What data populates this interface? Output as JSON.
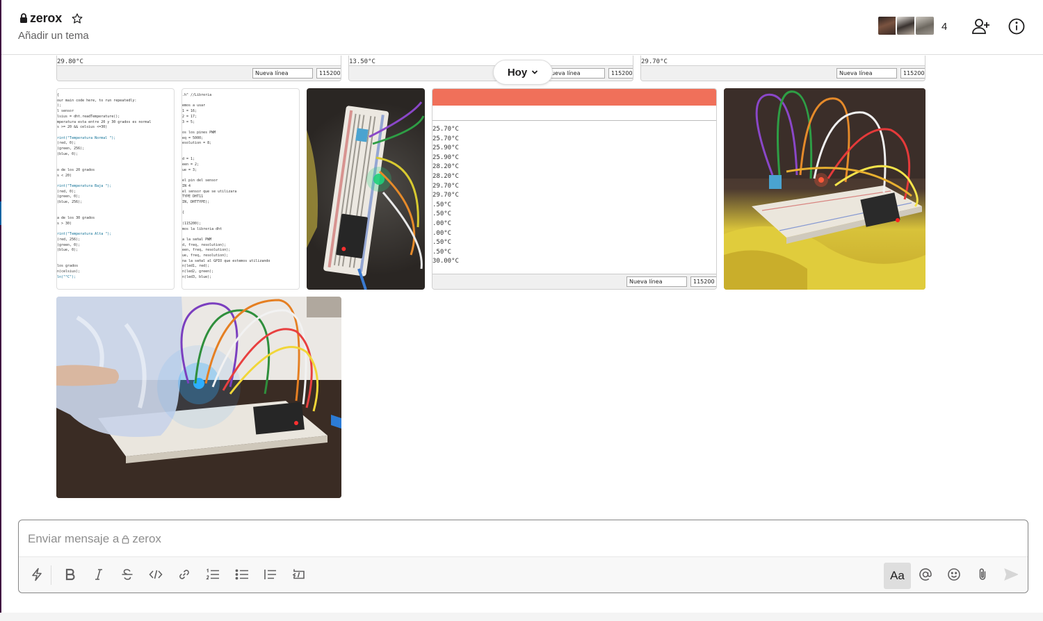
{
  "header": {
    "channel_name": "zerox",
    "topic": "Añadir un tema",
    "member_count": "4"
  },
  "serial_monitors_top": [
    {
      "reading": "29.80°C",
      "line_ending": "Nueva línea",
      "baud": "115200 b"
    },
    {
      "reading": "13.50°C",
      "line_ending": "Nueva línea",
      "baud": "115200 b"
    },
    {
      "reading": "29.70°C",
      "line_ending": "Nueva línea",
      "baud": "115200 b"
    }
  ],
  "date_divider": {
    "label": "Hoy"
  },
  "serial_monitor_big": {
    "readings": [
      "25.70°C",
      "25.70°C",
      "25.90°C",
      "25.90°C",
      "28.20°C",
      "28.20°C",
      "29.70°C",
      "29.70°C",
      ".50°C",
      ".50°C",
      ".00°C",
      ".00°C",
      ".50°C",
      ".50°C",
      "30.00°C"
    ],
    "line_ending": "Nueva línea",
    "baud": "115200 b"
  },
  "code_left": [
    "{",
    "our main code here, to run repeatedly:",
    ");",
    "l sensor",
    "lsius = dht.readTemperature();",
    "mperatura esta entre 20 y 30 grados es normal",
    "s >= 20 && celsius <=30)",
    "",
    "rint(\"Temperatura Normal \");",
    "(red, 0);",
    "(green, 256);",
    "(blue, 0);",
    "",
    "",
    "o de los 20 grados",
    "s < 20)",
    "",
    "rint(\"Temperatura Baja \");",
    "(red, 0);",
    "(green, 0);",
    "(blue, 256);",
    "",
    "",
    "a de los 30 grados",
    "s > 30)",
    "",
    "rint(\"Temperatura Alta \");",
    "(red, 256);",
    "(green, 0);",
    "(blue, 0);",
    "",
    "",
    "los grados",
    "n(celsius);",
    "ln(\"°C\");"
  ],
  "code_right": [
    ".h\" //Libreria",
    "",
    "emos a usar",
    "1 = 16;",
    "2 = 17;",
    "3 = 5;",
    "",
    "os los pines PWM",
    "eq = 5000;",
    "esolution = 8;",
    "",
    "",
    "d = 1;",
    "een = 2;",
    "ue = 3;",
    "",
    "el pin del sensor",
    "IN 4",
    "el sensor que se utilizara",
    "TYPE DHT11",
    "IN, DHTTYPE);",
    "",
    "{",
    "",
    "(115200);",
    "mos la libreria dht",
    "",
    "a la señal PWM",
    "d, freq, resolution);",
    "een, freq, resolution);",
    "ue, freq, resolution);",
    "na la señal al GPIO que estemos utilizando",
    "n(led1, red);",
    "n(led2, green);",
    "n(led3, blue);"
  ],
  "composer": {
    "placeholder_prefix": "Enviar mensaje a",
    "placeholder_channel": "zerox",
    "format_toggle": "Aa"
  },
  "icons": [
    "lock-icon",
    "star-icon",
    "add-member-icon",
    "info-icon",
    "shortcuts-icon",
    "bold-icon",
    "italic-icon",
    "strikethrough-icon",
    "code-icon",
    "link-icon",
    "ordered-list-icon",
    "bulleted-list-icon",
    "blockquote-icon",
    "code-block-icon",
    "mention-icon",
    "emoji-icon",
    "attach-icon",
    "send-icon",
    "chevron-down-icon"
  ]
}
